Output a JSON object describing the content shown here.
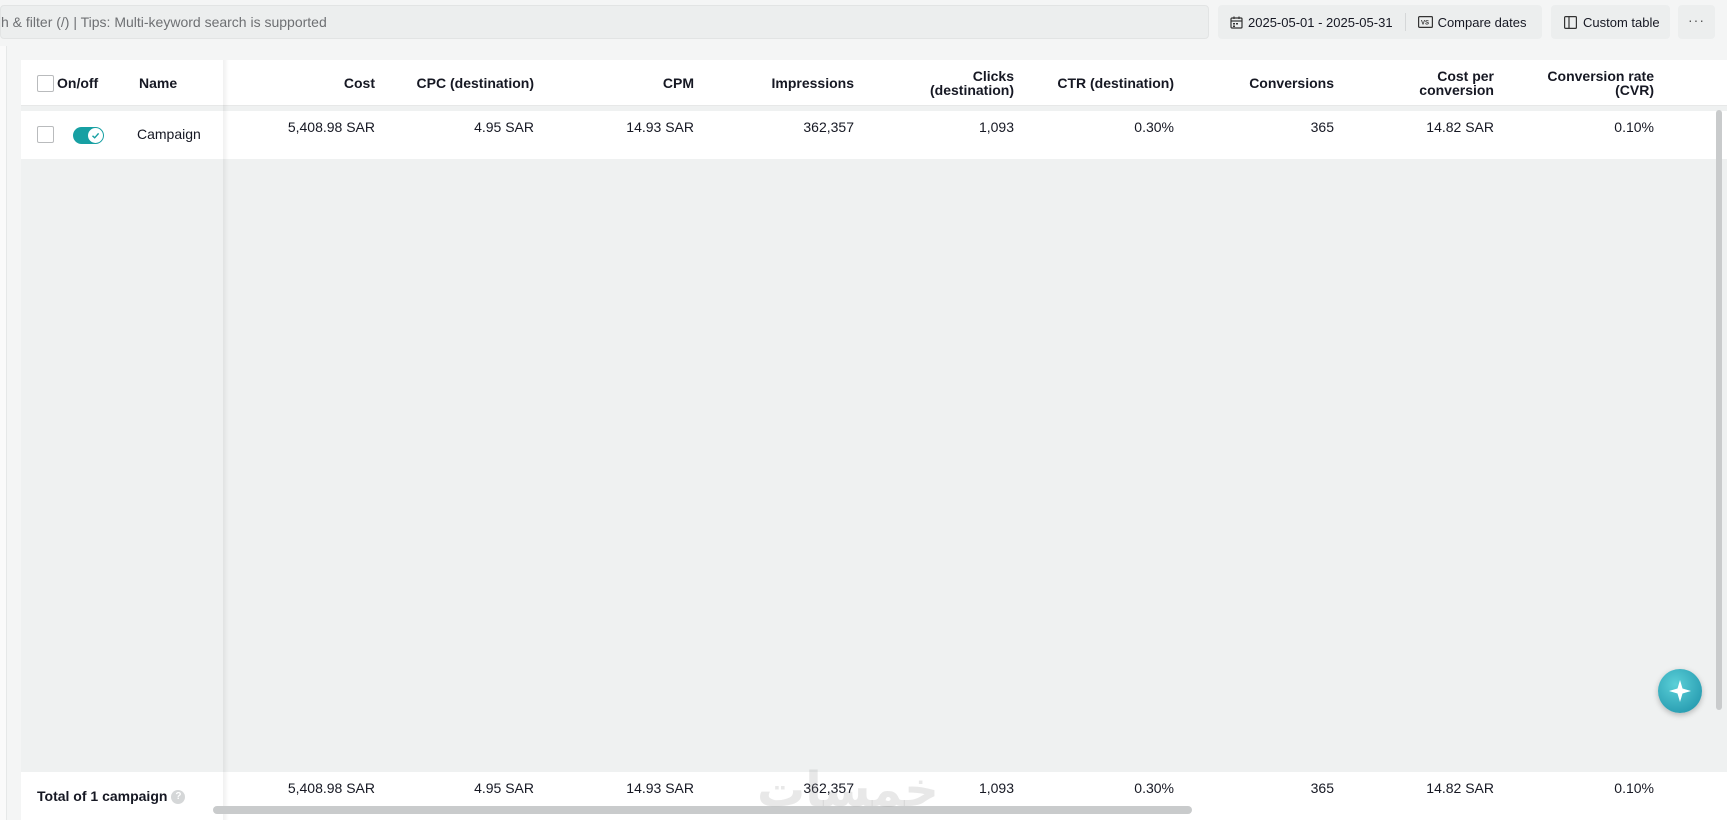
{
  "toolbar": {
    "search_placeholder": "h & filter (/) | Tips: Multi-keyword search is supported",
    "date_range": "2025-05-01 - 2025-05-31",
    "compare_dates": "Compare dates",
    "custom_table": "Custom table",
    "more": "···",
    "compare_icon_text": "VS"
  },
  "table": {
    "headers": {
      "onoff": "On/off",
      "name": "Name",
      "cost": "Cost",
      "cpc": "CPC (destination)",
      "cpm": "CPM",
      "impressions": "Impressions",
      "clicks_1": "Clicks",
      "clicks_2": "(destination)",
      "ctr": "CTR (destination)",
      "conversions": "Conversions",
      "cpconv_1": "Cost per",
      "cpconv_2": "conversion",
      "cvr_1": "Conversion rate",
      "cvr_2": "(CVR)"
    },
    "row": {
      "name": "Campaign",
      "status": "on",
      "cost": "5,408.98 SAR",
      "cpc": "4.95 SAR",
      "cpm": "14.93 SAR",
      "impressions": "362,357",
      "clicks": "1,093",
      "ctr": "0.30%",
      "conversions": "365",
      "cost_per_conversion": "14.82 SAR",
      "cvr": "0.10%"
    },
    "total": {
      "label": "Total of 1 campaign",
      "help": "?",
      "cost": "5,408.98 SAR",
      "cpc": "4.95 SAR",
      "cpm": "14.93 SAR",
      "impressions": "362,357",
      "clicks": "1,093",
      "ctr": "0.30%",
      "conversions": "365",
      "cost_per_conversion": "14.82 SAR",
      "cvr": "0.10%"
    }
  },
  "watermark": "خمسات",
  "colors": {
    "toggle_on": "#17a0a3",
    "assistant": "#1a8ea6"
  }
}
